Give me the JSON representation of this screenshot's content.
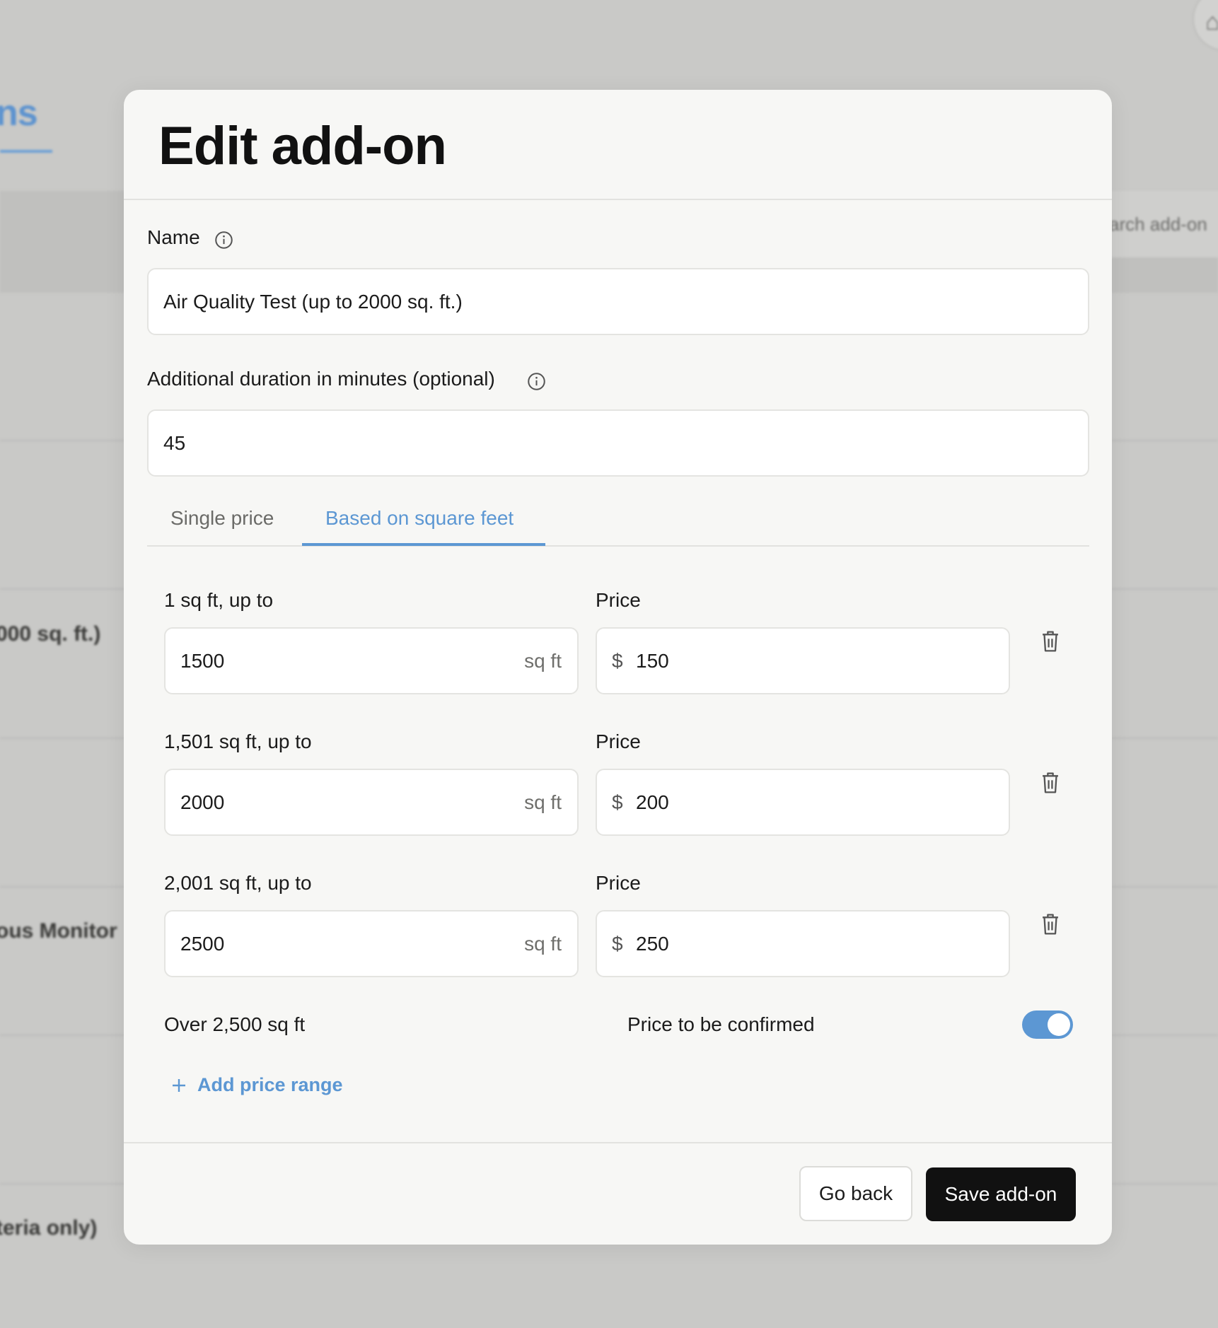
{
  "background": {
    "page_title_fragment": "ns",
    "search_placeholder_fragment": "arch add-on",
    "fab_glyph": "⌂",
    "rows": [
      "000 sq. ft.)",
      "ous Monitor",
      ")",
      "teria only)"
    ]
  },
  "modal": {
    "title": "Edit add-on",
    "name_label": "Name",
    "name_value": "Air Quality Test (up to 2000 sq. ft.)",
    "duration_label": "Additional duration in minutes (optional)",
    "duration_value": "45",
    "tabs": [
      {
        "label": "Single price",
        "active": false
      },
      {
        "label": "Based on square feet",
        "active": true
      }
    ],
    "ranges": [
      {
        "label": "1 sq ft, up to",
        "value": "1500",
        "unit": "sq ft",
        "price_label": "Price",
        "currency": "$",
        "price": "150"
      },
      {
        "label": "1,501 sq ft, up to",
        "value": "2000",
        "unit": "sq ft",
        "price_label": "Price",
        "currency": "$",
        "price": "200"
      },
      {
        "label": "2,001 sq ft, up to",
        "value": "2500",
        "unit": "sq ft",
        "price_label": "Price",
        "currency": "$",
        "price": "250"
      }
    ],
    "over_label": "Over 2,500 sq ft",
    "confirm_label": "Price to be confirmed",
    "confirm_toggle_on": true,
    "add_range_label": "Add price range",
    "go_back_label": "Go back",
    "save_label": "Save add-on"
  },
  "colors": {
    "accent": "#5c97d3",
    "primary_button": "#111111",
    "overlay": "#c9c9c7",
    "modal_bg": "#f7f7f5"
  },
  "icons": {
    "info": "info-circle-icon",
    "trash": "trash-icon",
    "plus": "plus-icon"
  }
}
